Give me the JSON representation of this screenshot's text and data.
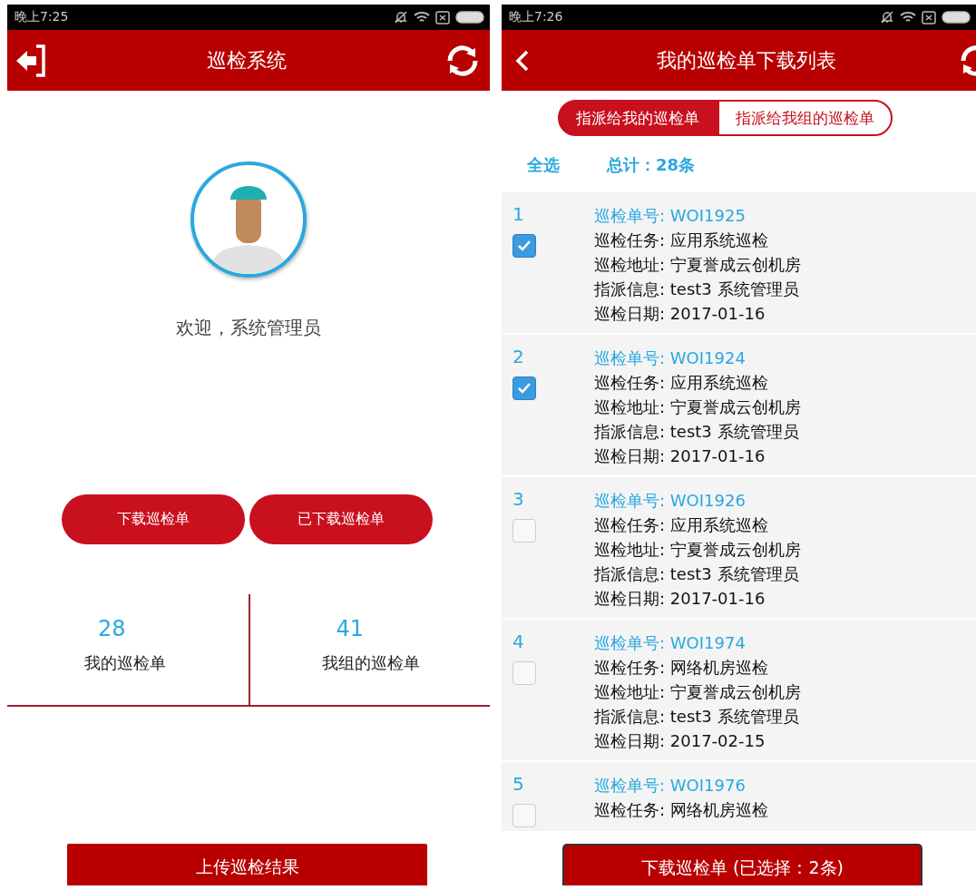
{
  "home": {
    "status_bar": {
      "time": "晚上7:25"
    },
    "header": {
      "title": "巡检系统"
    },
    "welcome": "欢迎，系统管理员",
    "buttons": [
      "下载巡检单",
      "已下载巡检单"
    ],
    "stats": [
      {
        "count": "28",
        "label": "我的巡检单"
      },
      {
        "count": "41",
        "label": "我组的巡检单"
      }
    ],
    "upload_button": "上传巡检结果"
  },
  "download_list": {
    "status_bar": {
      "time": "晚上7:26"
    },
    "header": {
      "title": "我的巡检单下载列表"
    },
    "tabs": [
      {
        "label": "指派给我的巡检单",
        "selected": true
      },
      {
        "label": "指派给我组的巡检单",
        "selected": false
      }
    ],
    "select_all": "全选",
    "total": "总计：28条",
    "items": [
      {
        "number": "1",
        "order_no": "巡检单号: WOI1925",
        "lines": [
          "巡检任务: 应用系统巡检",
          "巡检地址: 宁夏誉成云创机房",
          "指派信息: test3 系统管理员",
          "巡检日期: 2017-01-16"
        ],
        "checked": true
      },
      {
        "number": "2",
        "order_no": "巡检单号: WOI1924",
        "lines": [
          "巡检任务: 应用系统巡检",
          "巡检地址: 宁夏誉成云创机房",
          "指派信息: test3 系统管理员",
          "巡检日期: 2017-01-16"
        ],
        "checked": true
      },
      {
        "number": "3",
        "order_no": "巡检单号: WOI1926",
        "lines": [
          "巡检任务: 应用系统巡检",
          "巡检地址: 宁夏誉成云创机房",
          "指派信息: test3 系统管理员",
          "巡检日期: 2017-01-16"
        ],
        "checked": false
      },
      {
        "number": "4",
        "order_no": "巡检单号: WOI1974",
        "lines": [
          "巡检任务: 网络机房巡检",
          "巡检地址: 宁夏誉成云创机房",
          "指派信息: test3 系统管理员",
          "巡检日期: 2017-02-15"
        ],
        "checked": false
      },
      {
        "number": "5",
        "order_no": "巡检单号: WOI1976",
        "lines": [
          "巡检任务: 网络机房巡检"
        ],
        "checked": false
      }
    ],
    "download_button": "下载巡检单 (已选择：2条)"
  }
}
